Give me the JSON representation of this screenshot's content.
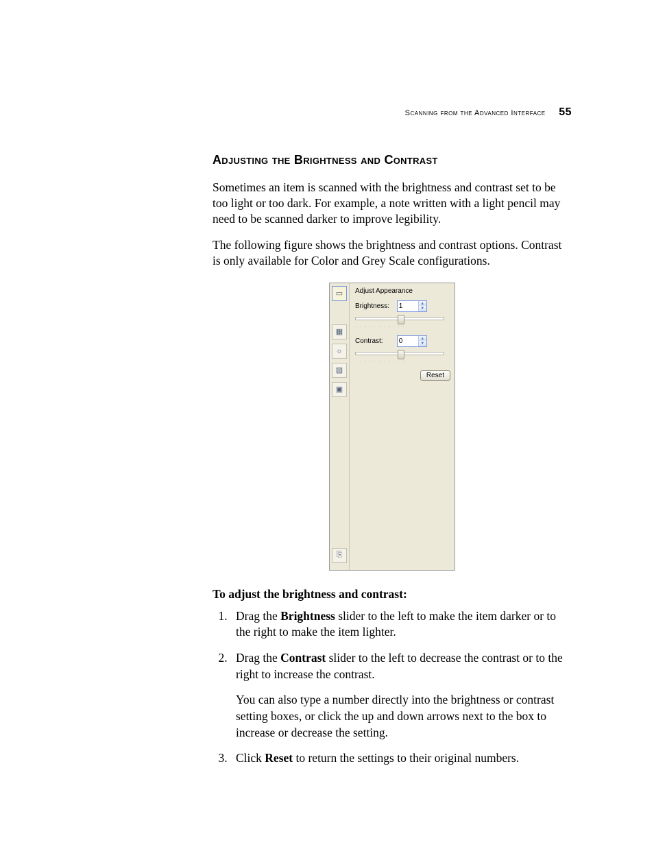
{
  "header": {
    "running": "Scanning from the Advanced Interface",
    "page_number": "55"
  },
  "section_title": "Adjusting the Brightness and Contrast",
  "paragraphs": {
    "p1": "Sometimes an item is scanned with the brightness and contrast set to be too light or too dark. For example, a note written with a light pencil may need to be scanned darker to improve legibility.",
    "p2": "The following figure shows the brightness and contrast options. Contrast is only available for Color and Grey Scale configurations."
  },
  "panel": {
    "title": "Adjust Appearance",
    "brightness_label": "Brightness:",
    "brightness_value": "1",
    "contrast_label": "Contrast:",
    "contrast_value": "0",
    "reset_label": "Reset",
    "icons": {
      "top": "document-icon",
      "grid": "pattern-icon",
      "sun": "brightness-icon",
      "eraser": "eraser-icon",
      "crop": "crop-icon",
      "bottom": "config-icon"
    }
  },
  "procedure": {
    "heading": "To adjust the brightness and contrast:",
    "steps": {
      "s1_pre": "Drag the ",
      "s1_bold": "Brightness",
      "s1_post": " slider to the left to make the item darker or to the right to make the item lighter.",
      "s2_pre": "Drag the ",
      "s2_bold": "Contrast",
      "s2_post": " slider to the left to decrease the contrast or to the right to increase the contrast.",
      "s2_extra": "You can also type a number directly into the brightness or contrast setting boxes, or click the up and down arrows next to the box to increase or decrease the setting.",
      "s3_pre": "Click ",
      "s3_bold": "Reset",
      "s3_post": " to return the settings to their original numbers."
    }
  }
}
